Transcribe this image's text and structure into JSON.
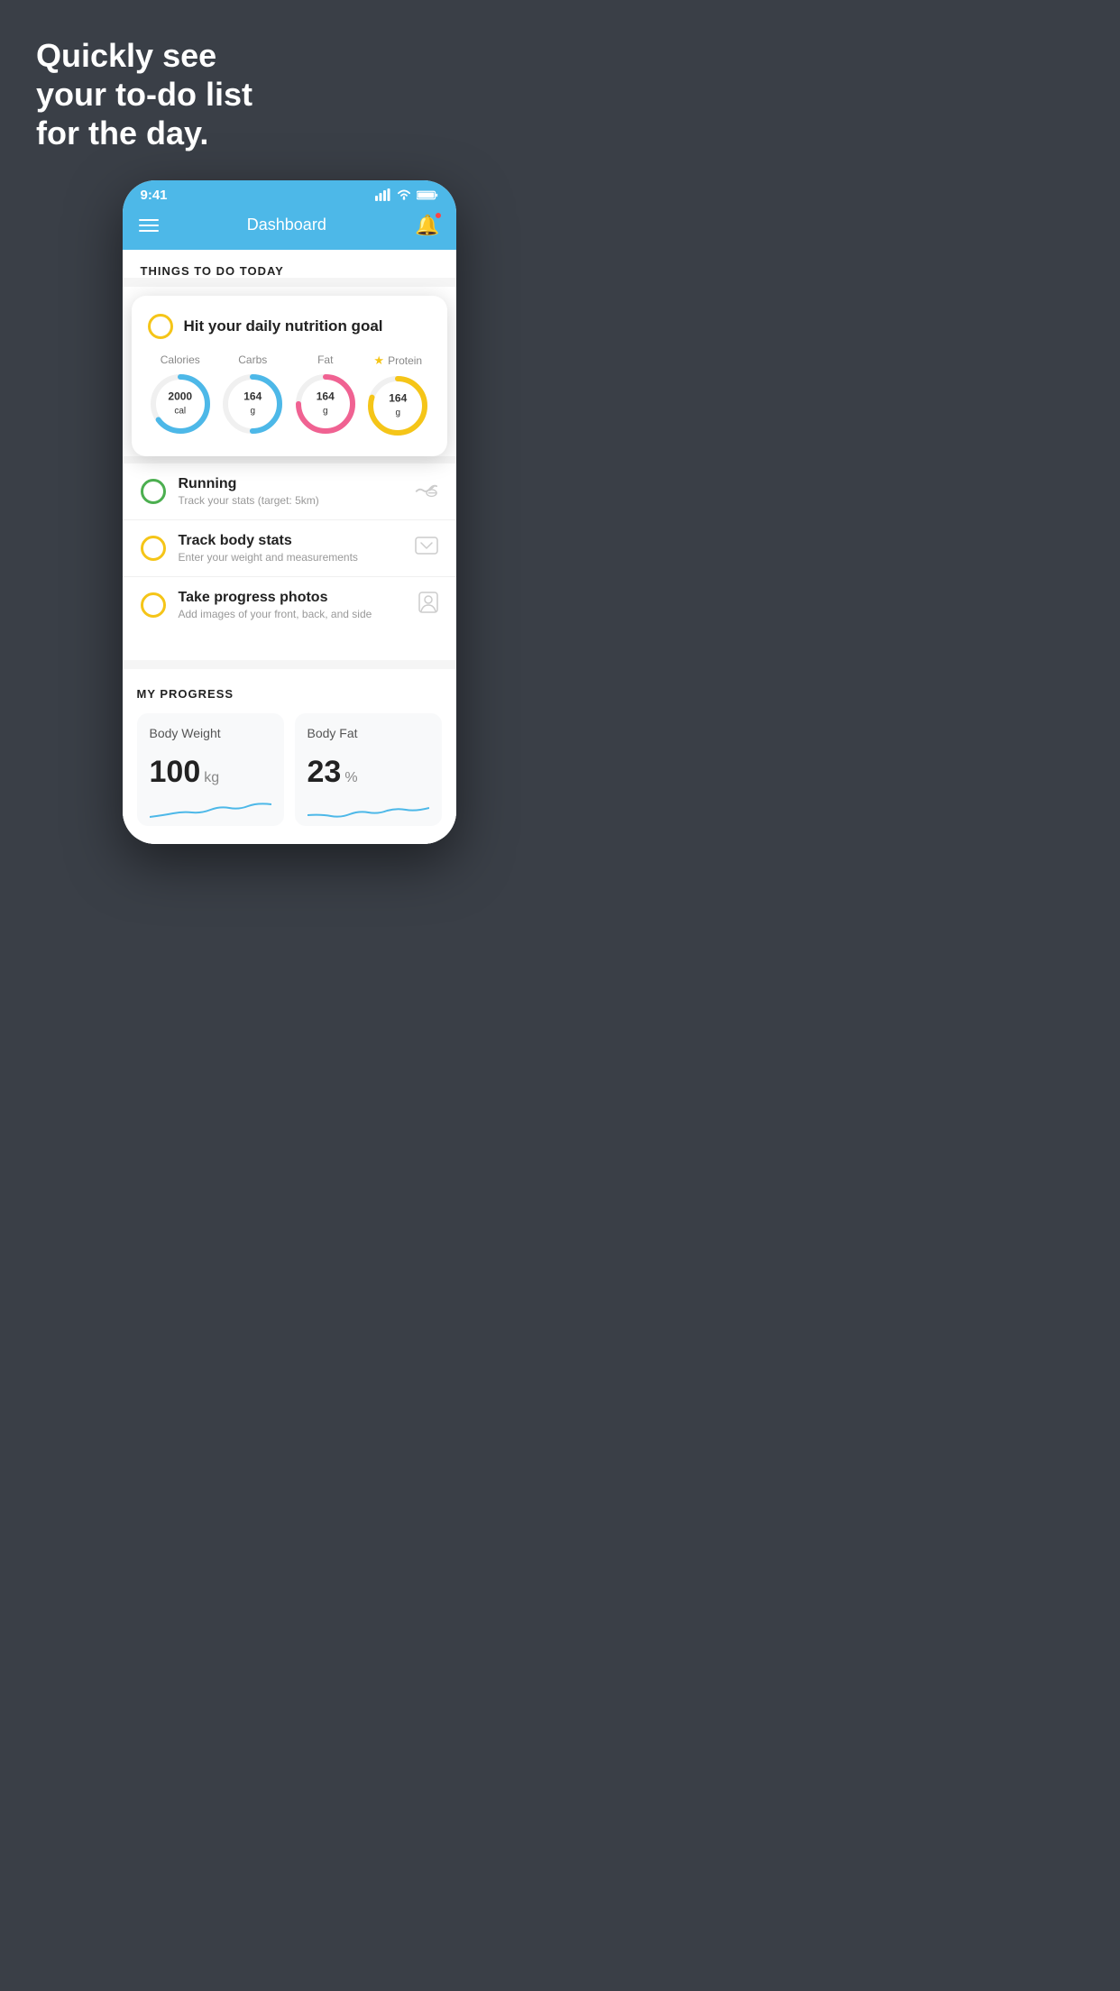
{
  "headline": {
    "line1": "Quickly see",
    "line2": "your to-do list",
    "line3": "for the day."
  },
  "phone": {
    "status_bar": {
      "time": "9:41",
      "signal_icon": "▌▌▌▌",
      "wifi_icon": "wifi",
      "battery_icon": "battery"
    },
    "nav": {
      "title": "Dashboard",
      "menu_icon": "hamburger",
      "bell_icon": "bell"
    },
    "things_to_do_title": "THINGS TO DO TODAY",
    "featured_card": {
      "circle_color": "yellow",
      "title": "Hit your daily nutrition goal",
      "items": [
        {
          "label": "Calories",
          "value": "2000",
          "unit": "cal",
          "color": "#4db8e8",
          "progress": 0.65
        },
        {
          "label": "Carbs",
          "value": "164",
          "unit": "g",
          "color": "#4db8e8",
          "progress": 0.5
        },
        {
          "label": "Fat",
          "value": "164",
          "unit": "g",
          "color": "#f06292",
          "progress": 0.75
        },
        {
          "label": "Protein",
          "value": "164",
          "unit": "g",
          "color": "#f5c518",
          "progress": 0.8,
          "starred": true
        }
      ]
    },
    "todo_items": [
      {
        "id": "running",
        "circle_color": "green",
        "title": "Running",
        "subtitle": "Track your stats (target: 5km)",
        "icon": "shoe"
      },
      {
        "id": "track-body",
        "circle_color": "yellow",
        "title": "Track body stats",
        "subtitle": "Enter your weight and measurements",
        "icon": "scale"
      },
      {
        "id": "progress-photos",
        "circle_color": "yellow",
        "title": "Take progress photos",
        "subtitle": "Add images of your front, back, and side",
        "icon": "person"
      }
    ],
    "progress_section": {
      "title": "MY PROGRESS",
      "cards": [
        {
          "id": "body-weight",
          "title": "Body Weight",
          "value": "100",
          "unit": "kg"
        },
        {
          "id": "body-fat",
          "title": "Body Fat",
          "value": "23",
          "unit": "%"
        }
      ]
    }
  }
}
